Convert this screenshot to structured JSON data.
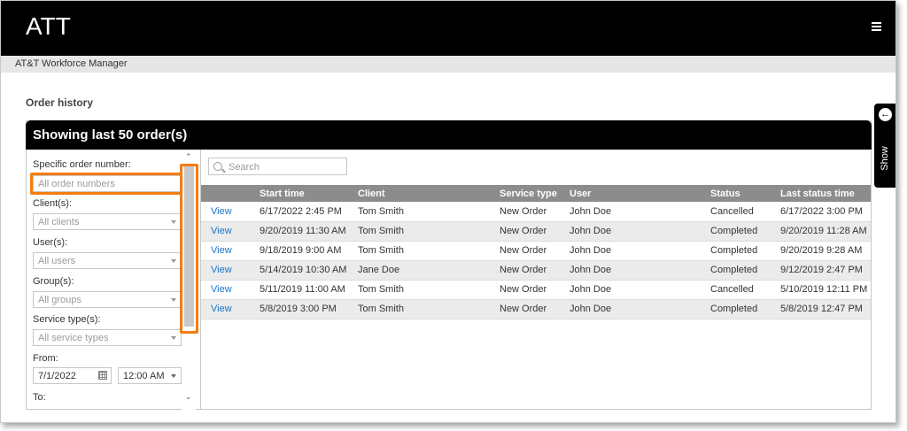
{
  "app": {
    "brand": "ATT",
    "subtitle": "AT&T Workforce Manager",
    "menu_icon": "hamburger-icon"
  },
  "page": {
    "title": "Order history"
  },
  "side_tab": {
    "label": "Show",
    "icon": "arrow-left-circle-icon"
  },
  "panel": {
    "title": "Showing last 50 order(s)"
  },
  "filters": {
    "order_number": {
      "label": "Specific order number:",
      "placeholder": "All order numbers"
    },
    "clients": {
      "label": "Client(s):",
      "placeholder": "All clients"
    },
    "users": {
      "label": "User(s):",
      "placeholder": "All users"
    },
    "groups": {
      "label": "Group(s):",
      "placeholder": "All groups"
    },
    "service_types": {
      "label": "Service type(s):",
      "placeholder": "All service types"
    },
    "from": {
      "label": "From:",
      "date": "7/1/2022",
      "time": "12:00 AM"
    },
    "to": {
      "label": "To:"
    }
  },
  "search": {
    "placeholder": "Search"
  },
  "table": {
    "columns": [
      "",
      "Start time",
      "Client",
      "Service type",
      "User",
      "Status",
      "Last status time"
    ],
    "rows": [
      [
        "View",
        "6/17/2022 2:45 PM",
        "Tom Smith",
        "New Order",
        "John Doe",
        "Cancelled",
        "6/17/2022 3:00 PM"
      ],
      [
        "View",
        "9/20/2019 11:30 AM",
        "Tom Smith",
        "New Order",
        "John Doe",
        "Completed",
        "9/20/2019 11:28 AM"
      ],
      [
        "View",
        "9/18/2019 9:00 AM",
        "Tom Smith",
        "New Order",
        "John Doe",
        "Completed",
        "9/20/2019 9:28 AM"
      ],
      [
        "View",
        "5/14/2019 10:30 AM",
        "Jane Doe",
        "New Order",
        "John Doe",
        "Completed",
        "9/12/2019 2:47 PM"
      ],
      [
        "View",
        "5/11/2019 11:00 AM",
        "Tom Smith",
        "New Order",
        "John Doe",
        "Cancelled",
        "5/10/2019 12:11 PM"
      ],
      [
        "View",
        "5/8/2019 3:00 PM",
        "Tom Smith",
        "New Order",
        "John Doe",
        "Completed",
        "5/8/2019 12:47 PM"
      ]
    ]
  },
  "colors": {
    "header": "#000000",
    "highlight": "#f57c12",
    "link": "#1a73c9",
    "table_header": "#8c8c8c"
  }
}
